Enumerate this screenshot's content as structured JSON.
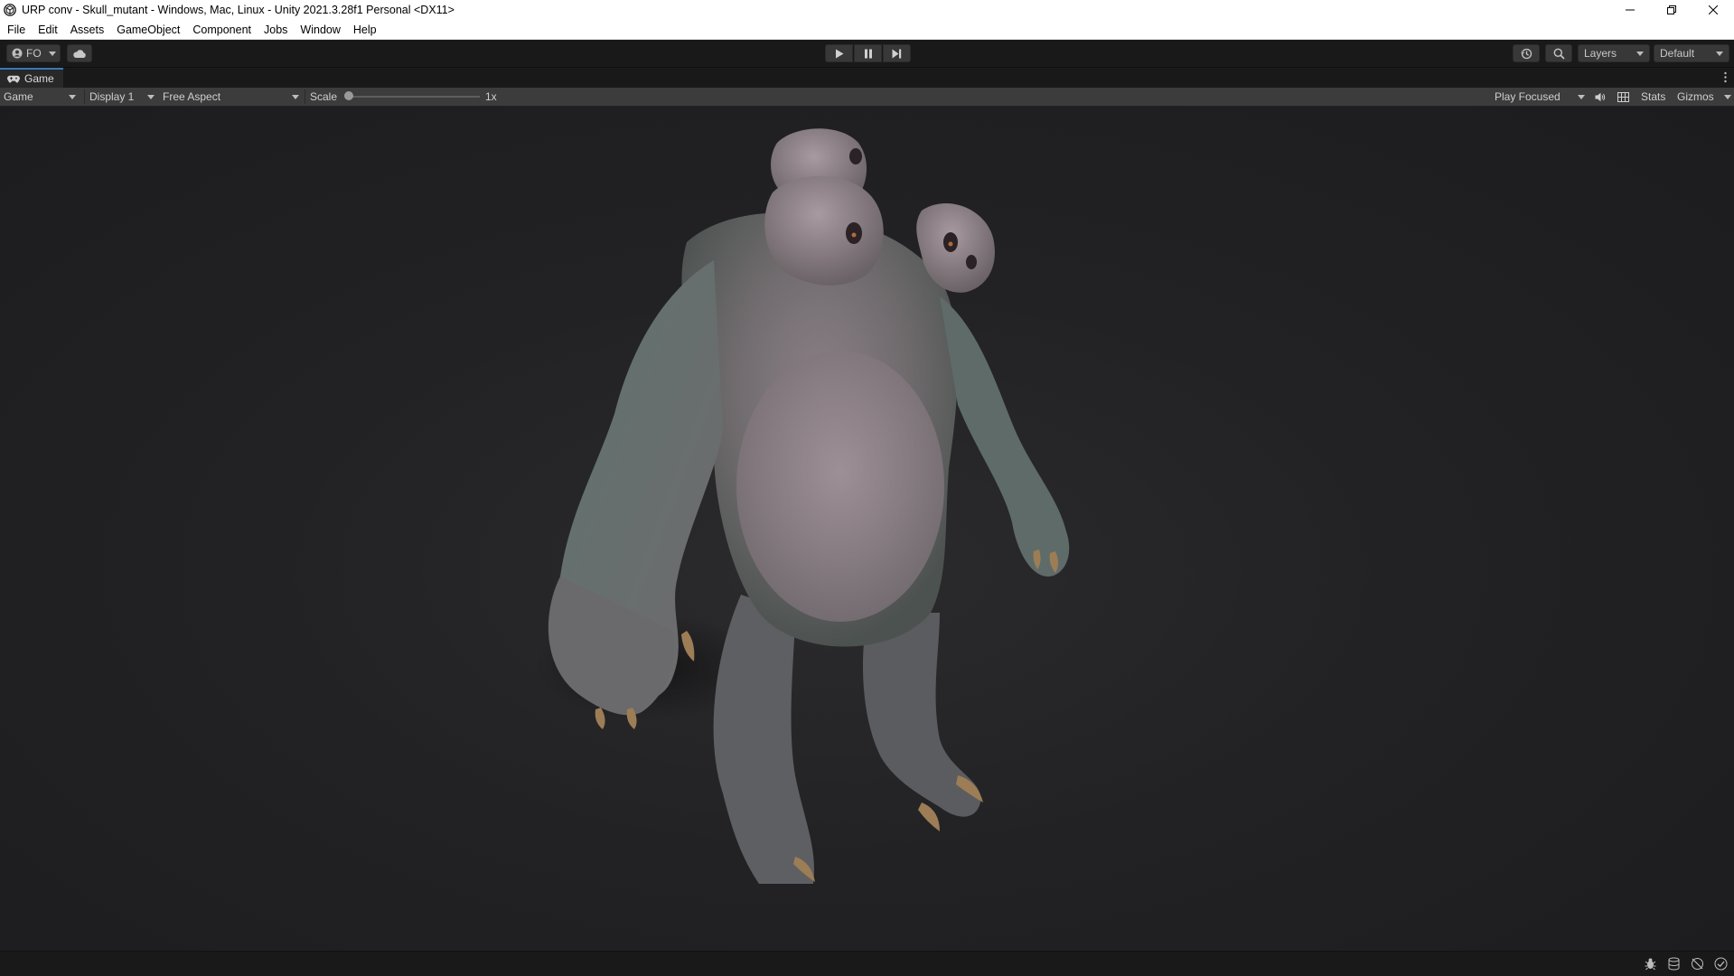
{
  "window": {
    "title": "URP conv - Skull_mutant - Windows, Mac, Linux - Unity 2021.3.28f1 Personal <DX11>"
  },
  "menu": [
    "File",
    "Edit",
    "Assets",
    "GameObject",
    "Component",
    "Jobs",
    "Window",
    "Help"
  ],
  "toolbar": {
    "account_label": "FO",
    "layers_label": "Layers",
    "layout_label": "Default"
  },
  "tab": {
    "label": "Game"
  },
  "game_toolbar": {
    "view_mode": "Game",
    "display": "Display 1",
    "aspect": "Free Aspect",
    "scale_label": "Scale",
    "scale_value_label": "1x",
    "scale_fraction": 0.0,
    "play_mode": "Play Focused",
    "stats_label": "Stats",
    "gizmos_label": "Gizmos"
  },
  "icons": {
    "title": "unity-logo-icon",
    "minimize": "minimize-icon",
    "maximize": "restore-icon",
    "close": "close-icon",
    "play": "play-icon",
    "pause": "pause-icon",
    "step": "step-icon",
    "history": "history-icon",
    "search": "search-icon",
    "cloud": "cloud-icon",
    "mute": "audio-mute-icon",
    "stats_grid": "grid-icon"
  },
  "colors": {
    "tab_accent": "#3a79bb",
    "editor_bg": "#191919",
    "viewport_bg": "#222224",
    "creature_skin": "#6b6a6c"
  }
}
